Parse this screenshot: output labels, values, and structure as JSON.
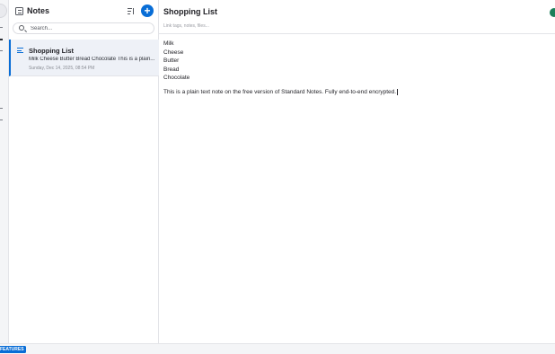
{
  "list": {
    "title": "Notes",
    "add_label": "+",
    "search_placeholder": "Search..."
  },
  "notes": [
    {
      "title": "Shopping List",
      "preview": "Milk Cheese Butter Bread Chocolate This is a plain...",
      "date": "Sunday, Dec 14, 2025, 08:54 PM"
    }
  ],
  "editor": {
    "title": "Shopping List",
    "tags_placeholder": "Link tags, notes, files...",
    "lines": [
      "Milk",
      "Cheese",
      "Butter",
      "Bread",
      "Chocolate"
    ],
    "paragraph": "This is a plain text note on the free version of Standard Notes. Fully end-to-end encrypted."
  },
  "footer": {
    "features_label": "FEATURES"
  },
  "colors": {
    "accent": "#086dd6",
    "status": "#1b7f5a",
    "selected_row": "#eef1f7"
  }
}
